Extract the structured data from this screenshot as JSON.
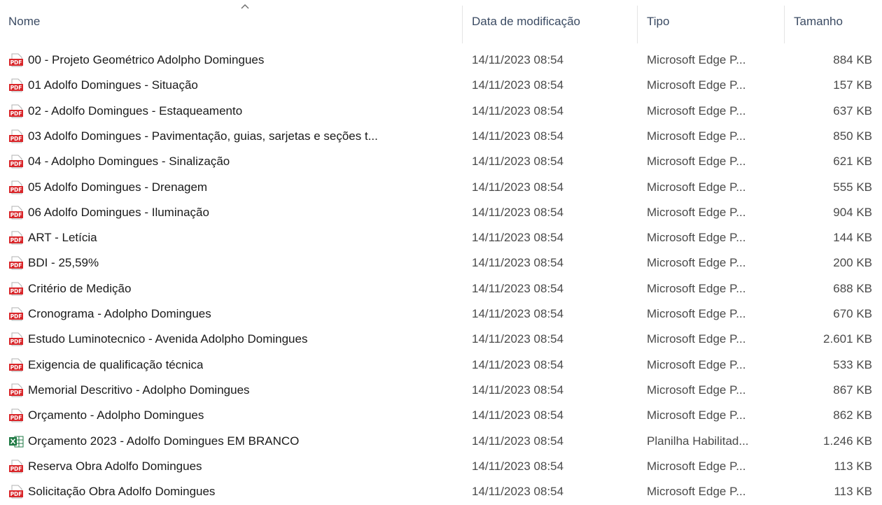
{
  "columns": {
    "name": "Nome",
    "date": "Data de modificação",
    "type": "Tipo",
    "size": "Tamanho"
  },
  "sort": {
    "column": "name",
    "direction": "ascending",
    "icon": "chevron-up-icon"
  },
  "files": [
    {
      "icon": "pdf-file-icon",
      "name": "00 - Projeto Geométrico Adolpho Domingues",
      "date": "14/11/2023 08:54",
      "type": "Microsoft Edge P...",
      "size": "884 KB"
    },
    {
      "icon": "pdf-file-icon",
      "name": "01 Adolfo Domingues - Situação",
      "date": "14/11/2023 08:54",
      "type": "Microsoft Edge P...",
      "size": "157 KB"
    },
    {
      "icon": "pdf-file-icon",
      "name": "02 - Adolfo Domingues - Estaqueamento",
      "date": "14/11/2023 08:54",
      "type": "Microsoft Edge P...",
      "size": "637 KB"
    },
    {
      "icon": "pdf-file-icon",
      "name": "03 Adolfo Domingues - Pavimentação, guias, sarjetas e seções t...",
      "date": "14/11/2023 08:54",
      "type": "Microsoft Edge P...",
      "size": "850 KB"
    },
    {
      "icon": "pdf-file-icon",
      "name": "04 - Adolpho Domingues - Sinalização",
      "date": "14/11/2023 08:54",
      "type": "Microsoft Edge P...",
      "size": "621 KB"
    },
    {
      "icon": "pdf-file-icon",
      "name": "05 Adolfo Domingues - Drenagem",
      "date": "14/11/2023 08:54",
      "type": "Microsoft Edge P...",
      "size": "555 KB"
    },
    {
      "icon": "pdf-file-icon",
      "name": "06 Adolfo Domingues - Iluminação",
      "date": "14/11/2023 08:54",
      "type": "Microsoft Edge P...",
      "size": "904 KB"
    },
    {
      "icon": "pdf-file-icon",
      "name": "ART - Letícia",
      "date": "14/11/2023 08:54",
      "type": "Microsoft Edge P...",
      "size": "144 KB"
    },
    {
      "icon": "pdf-file-icon",
      "name": "BDI - 25,59%",
      "date": "14/11/2023 08:54",
      "type": "Microsoft Edge P...",
      "size": "200 KB"
    },
    {
      "icon": "pdf-file-icon",
      "name": "Critério de Medição",
      "date": "14/11/2023 08:54",
      "type": "Microsoft Edge P...",
      "size": "688 KB"
    },
    {
      "icon": "pdf-file-icon",
      "name": "Cronograma - Adolpho Domingues",
      "date": "14/11/2023 08:54",
      "type": "Microsoft Edge P...",
      "size": "670 KB"
    },
    {
      "icon": "pdf-file-icon",
      "name": "Estudo Luminotecnico - Avenida Adolpho Domingues",
      "date": "14/11/2023 08:54",
      "type": "Microsoft Edge P...",
      "size": "2.601 KB"
    },
    {
      "icon": "pdf-file-icon",
      "name": "Exigencia de qualificação técnica",
      "date": "14/11/2023 08:54",
      "type": "Microsoft Edge P...",
      "size": "533 KB"
    },
    {
      "icon": "pdf-file-icon",
      "name": "Memorial Descritivo - Adolpho Domingues",
      "date": "14/11/2023 08:54",
      "type": "Microsoft Edge P...",
      "size": "867 KB"
    },
    {
      "icon": "pdf-file-icon",
      "name": "Orçamento - Adolpho Domingues",
      "date": "14/11/2023 08:54",
      "type": "Microsoft Edge P...",
      "size": "862 KB"
    },
    {
      "icon": "spreadsheet-file-icon",
      "name": "Orçamento 2023 - Adolfo Domingues EM BRANCO",
      "date": "14/11/2023 08:54",
      "type": "Planilha Habilitad...",
      "size": "1.246 KB"
    },
    {
      "icon": "pdf-file-icon",
      "name": "Reserva Obra Adolfo Domingues",
      "date": "14/11/2023 08:54",
      "type": "Microsoft Edge P...",
      "size": "113 KB"
    },
    {
      "icon": "pdf-file-icon",
      "name": "Solicitação Obra Adolfo Domingues",
      "date": "14/11/2023 08:54",
      "type": "Microsoft Edge P...",
      "size": "113 KB"
    }
  ],
  "colors": {
    "pdf_icon": "#d9262a",
    "spreadsheet_icon": "#1f7a44",
    "header_text": "#3b4b63"
  }
}
